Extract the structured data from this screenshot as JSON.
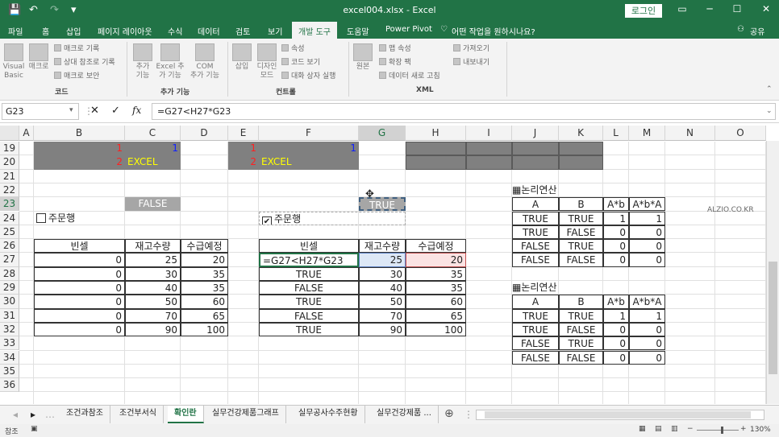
{
  "window": {
    "title": "excel004.xlsx - Excel",
    "login_label": "로그인",
    "min": "─",
    "max": "☐",
    "close": "✕",
    "restore": "▭"
  },
  "quick_access": {
    "save": "💾",
    "undo": "↶",
    "redo": "↷",
    "more": "▾"
  },
  "tabs": [
    "파일",
    "홈",
    "삽입",
    "페이지 레이아웃",
    "수식",
    "데이터",
    "검토",
    "보기",
    "개발 도구",
    "도움말",
    "Power Pivot"
  ],
  "tell_me": "어떤 작업을 원하시나요?",
  "share": "공유",
  "ribbon": {
    "code": {
      "vb": "Visual\nBasic",
      "macro": "매크로",
      "record": "매크로 기록",
      "relative": "상대 참조로 기록",
      "security": "매크로 보안",
      "group": "코드"
    },
    "addins": {
      "addin": "추가\n기능",
      "excel": "Excel 추\n가 기능",
      "com": "COM\n추가 기능",
      "group": "추가 기능"
    },
    "controls": {
      "insert": "삽입",
      "design": "디자인\n모드",
      "props": "속성",
      "viewcode": "코드 보기",
      "dialog": "대화 상자 실행",
      "group": "컨트롤"
    },
    "xml": {
      "source": "원본",
      "mapprops": "맵 속성",
      "expansion": "확장 팩",
      "refresh": "데이터 새로 고침",
      "import": "가져오기",
      "export": "내보내기",
      "group": "XML"
    }
  },
  "formula_bar": {
    "name_box": "G23",
    "formula": "=G27<H27*G23",
    "cancel": "✕",
    "enter": "✓",
    "fx": "fx"
  },
  "columns": [
    "A",
    "B",
    "C",
    "D",
    "E",
    "F",
    "G",
    "H",
    "I",
    "J",
    "K",
    "L",
    "M",
    "N",
    "O"
  ],
  "rows": [
    "19",
    "20",
    "21",
    "22",
    "23",
    "24",
    "25",
    "26",
    "27",
    "28",
    "29",
    "30",
    "31",
    "32",
    "33",
    "34",
    "35",
    "36"
  ],
  "cells": {
    "B19": "1",
    "C19": "1",
    "E19": "1",
    "F19": "1",
    "B20": "2",
    "C20": "EXCEL",
    "E20": "2",
    "F20": "EXCEL",
    "C23": "FALSE",
    "G23": "TRUE",
    "B24_check": "주문행",
    "F24_check": "주문행",
    "F24_mark": "✔",
    "watermark": "ALZIO.CO.KR"
  },
  "left_table": {
    "headers": [
      "빈셀",
      "재고수량",
      "수급예정"
    ],
    "rows": [
      [
        "0",
        "25",
        "20"
      ],
      [
        "0",
        "30",
        "35"
      ],
      [
        "0",
        "40",
        "35"
      ],
      [
        "0",
        "50",
        "60"
      ],
      [
        "0",
        "70",
        "65"
      ],
      [
        "0",
        "90",
        "100"
      ]
    ]
  },
  "mid_table": {
    "headers": [
      "빈셀",
      "재고수량",
      "수급예정"
    ],
    "rows": [
      [
        "=G27<H27*G23",
        "25",
        "20"
      ],
      [
        "TRUE",
        "30",
        "35"
      ],
      [
        "FALSE",
        "40",
        "35"
      ],
      [
        "TRUE",
        "50",
        "60"
      ],
      [
        "FALSE",
        "70",
        "65"
      ],
      [
        "TRUE",
        "90",
        "100"
      ]
    ]
  },
  "logic_tables": [
    {
      "title": "▦논리연산",
      "headers": [
        "A",
        "B",
        "A*b",
        "A*b*A"
      ],
      "rows": [
        [
          "TRUE",
          "TRUE",
          "1",
          "1"
        ],
        [
          "TRUE",
          "FALSE",
          "0",
          "0"
        ],
        [
          "FALSE",
          "TRUE",
          "0",
          "0"
        ],
        [
          "FALSE",
          "FALSE",
          "0",
          "0"
        ]
      ]
    },
    {
      "title": "▦논리연산",
      "headers": [
        "A",
        "B",
        "A*b",
        "A*b*A"
      ],
      "rows": [
        [
          "TRUE",
          "TRUE",
          "1",
          "1"
        ],
        [
          "TRUE",
          "FALSE",
          "0",
          "0"
        ],
        [
          "FALSE",
          "TRUE",
          "0",
          "0"
        ],
        [
          "FALSE",
          "FALSE",
          "0",
          "0"
        ]
      ]
    }
  ],
  "sheet_tabs": [
    "조건과참조",
    "조건부서식",
    "확인란",
    "실무건강제품그래프",
    "실무공사수주현황",
    "실무건강제품 ..."
  ],
  "active_sheet": 2,
  "status": {
    "ready": "참조",
    "zoom": "130%"
  },
  "colors": {
    "accent": "#217346",
    "gray_fill": "#808080",
    "yellow_text": "#ffff00"
  }
}
